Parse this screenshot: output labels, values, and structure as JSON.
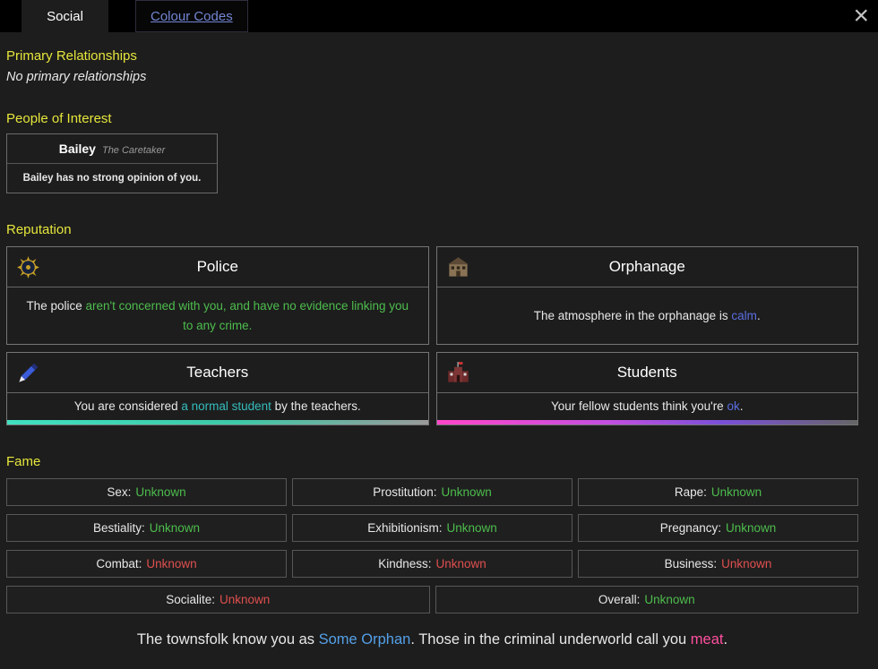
{
  "colors": {
    "yellow": "#e6e63c",
    "green": "#4dbd4d",
    "blue": "#5b6ee1",
    "teal": "#35bcbc",
    "lightblue": "#54a0e8",
    "red": "#e04f4f",
    "pink": "#ff4f9e",
    "link": "#7286d3"
  },
  "tabs": {
    "social": "Social",
    "colour": "Colour Codes",
    "close": "×"
  },
  "primary": {
    "heading": "Primary Relationships",
    "empty": "No primary relationships"
  },
  "people": {
    "heading": "People of Interest",
    "card": {
      "name": "Bailey",
      "title": "The Caretaker",
      "opinion": "Bailey has no strong opinion of you."
    }
  },
  "reputation": {
    "heading": "Reputation",
    "police": {
      "title": "Police",
      "icon": "police-badge-icon",
      "parts": {
        "a": "The police ",
        "b": "aren't concerned with you, and have no evidence linking you to any crime."
      }
    },
    "orphanage": {
      "title": "Orphanage",
      "icon": "orphanage-icon",
      "parts": {
        "a": "The atmosphere in the orphanage is ",
        "b": "calm",
        "c": "."
      }
    },
    "teachers": {
      "title": "Teachers",
      "icon": "pencil-icon",
      "parts": {
        "a": "You are considered ",
        "b": "a normal student",
        "c": " by the teachers."
      }
    },
    "students": {
      "title": "Students",
      "icon": "school-icon",
      "parts": {
        "a": "Your fellow students think you're ",
        "b": "ok",
        "c": "."
      }
    }
  },
  "fame": {
    "heading": "Fame",
    "items": [
      {
        "label": "Sex:",
        "value": "Unknown",
        "color": "green"
      },
      {
        "label": "Prostitution:",
        "value": "Unknown",
        "color": "green"
      },
      {
        "label": "Rape:",
        "value": "Unknown",
        "color": "green"
      },
      {
        "label": "Bestiality:",
        "value": "Unknown",
        "color": "green"
      },
      {
        "label": "Exhibitionism:",
        "value": "Unknown",
        "color": "green"
      },
      {
        "label": "Pregnancy:",
        "value": "Unknown",
        "color": "green"
      },
      {
        "label": "Combat:",
        "value": "Unknown",
        "color": "red"
      },
      {
        "label": "Kindness:",
        "value": "Unknown",
        "color": "red"
      },
      {
        "label": "Business:",
        "value": "Unknown",
        "color": "red"
      },
      {
        "label": "Socialite:",
        "value": "Unknown",
        "color": "red"
      },
      {
        "label": "Overall:",
        "value": "Unknown",
        "color": "green"
      }
    ]
  },
  "footer": {
    "a": "The townsfolk know you as ",
    "b": "Some Orphan",
    "c": ". Those in the criminal underworld call you ",
    "d": "meat",
    "e": "."
  }
}
